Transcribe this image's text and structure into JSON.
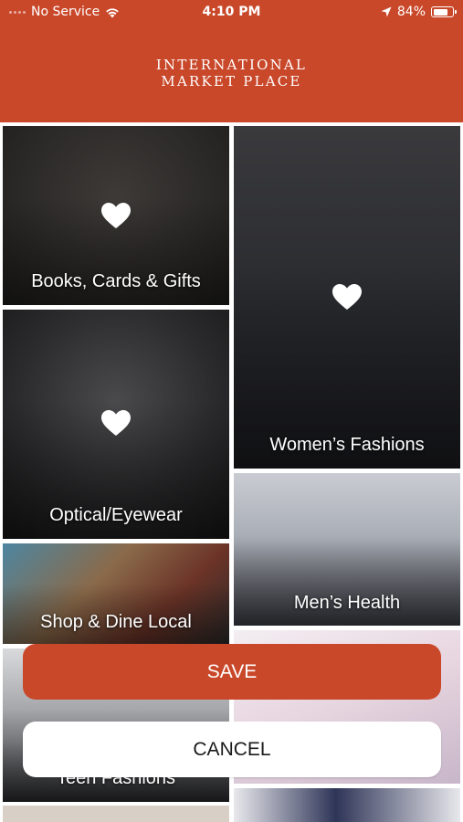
{
  "colors": {
    "accent": "#c9482a",
    "tile_text": "#ffffff"
  },
  "status_bar": {
    "carrier": "No Service",
    "time": "4:10 PM",
    "battery_percent": "84%",
    "battery_level": 0.84,
    "icons": [
      "signal-icon",
      "wifi-icon",
      "location-icon",
      "battery-icon"
    ]
  },
  "header": {
    "logo_line1": "INTERNATIONAL",
    "logo_line2": "MARKET PLACE"
  },
  "categories": [
    {
      "label": "Books, Cards & Gifts",
      "favorite": true,
      "icon": "heart-icon"
    },
    {
      "label": "Women’s Fashions",
      "favorite": true,
      "icon": "heart-icon"
    },
    {
      "label": "Optical/Eyewear",
      "favorite": true,
      "icon": "heart-icon"
    },
    {
      "label": "Men’s Health",
      "favorite": false
    },
    {
      "label": "Shop & Dine Local",
      "favorite": false
    },
    {
      "label": "Teen Fashions",
      "favorite": false
    }
  ],
  "actions": {
    "save_label": "SAVE",
    "cancel_label": "CANCEL"
  }
}
